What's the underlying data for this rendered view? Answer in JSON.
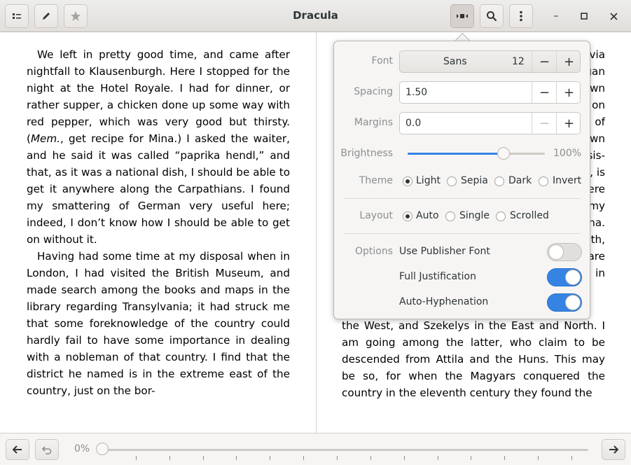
{
  "window": {
    "title": "Dracula"
  },
  "header": {
    "buttons": {
      "contents": "contents-icon",
      "annotate": "pencil-icon",
      "bookmark": "star-icon",
      "view": "view-options-icon",
      "search": "search-icon",
      "menu": "menu-icon"
    },
    "window_controls": {
      "minimize": "–",
      "maximize": "□",
      "close": "✕"
    }
  },
  "book": {
    "left_page": [
      "We left in pretty good time, and came after nightfall to Klausenburgh. Here I stopped for the night at the Hotel Royale. I had for dinner, or rather supper, a chicken done up some way with red pepper, which was very good but thirsty. (",
      "Mem.",
      ", get recipe for Mina.) I asked the waiter, and he said it was called “paprika hendl,” and that, as it was a national dish, I should be able to get it anywhere along the Carpathians. I found my smattering of German very useful here; indeed, I don’t know how I should be able to get on without it.",
      "Having had some time at my disposal when in London, I had visited the British Museum, and made search among the books and maps in the library regarding Transylvania; it had struck me that some foreknowledge of the country could hardly fail to have some import­ance in dealing with a nobleman of that coun­try. I find that the district he named is in the extreme east of the country, just on the bor-"
    ],
    "right_page_visible_edges": [
      "via",
      "gan",
      "wn",
      "on",
      "of",
      "wn",
      "sis-",
      ", is",
      "ere",
      "my",
      "na.",
      "th,",
      "are",
      "in"
    ],
    "right_page_tail": "the West, and Szekelys in the East and North. I am going among the latter, who claim to be descended from Attila and the Huns. This may be so, for when the Magyars conquered the country in the eleventh century they found the"
  },
  "popover": {
    "font": {
      "label": "Font",
      "family": "Sans",
      "size": "12"
    },
    "spacing": {
      "label": "Spacing",
      "value": "1.50"
    },
    "margins": {
      "label": "Margins",
      "value": "0.0"
    },
    "brightness": {
      "label": "Brightness",
      "value_text": "100%",
      "level": 0.7
    },
    "theme": {
      "label": "Theme",
      "options": [
        "Light",
        "Sepia",
        "Dark",
        "Invert"
      ],
      "selected": "Light"
    },
    "layout": {
      "label": "Layout",
      "options": [
        "Auto",
        "Single",
        "Scrolled"
      ],
      "selected": "Auto"
    },
    "options": {
      "label": "Options",
      "publisher_font": {
        "label": "Use Publisher Font",
        "on": false
      },
      "full_justification": {
        "label": "Full Justification",
        "on": true
      },
      "auto_hyphenation": {
        "label": "Auto-Hyphenation",
        "on": true
      }
    },
    "spin": {
      "minus": "−",
      "plus": "+"
    }
  },
  "footer": {
    "progress_text": "0%",
    "progress": 0.0,
    "back": "back-arrow-icon",
    "undo": "undo-icon",
    "forward": "forward-arrow-icon"
  },
  "colors": {
    "accent": "#3584e4"
  }
}
